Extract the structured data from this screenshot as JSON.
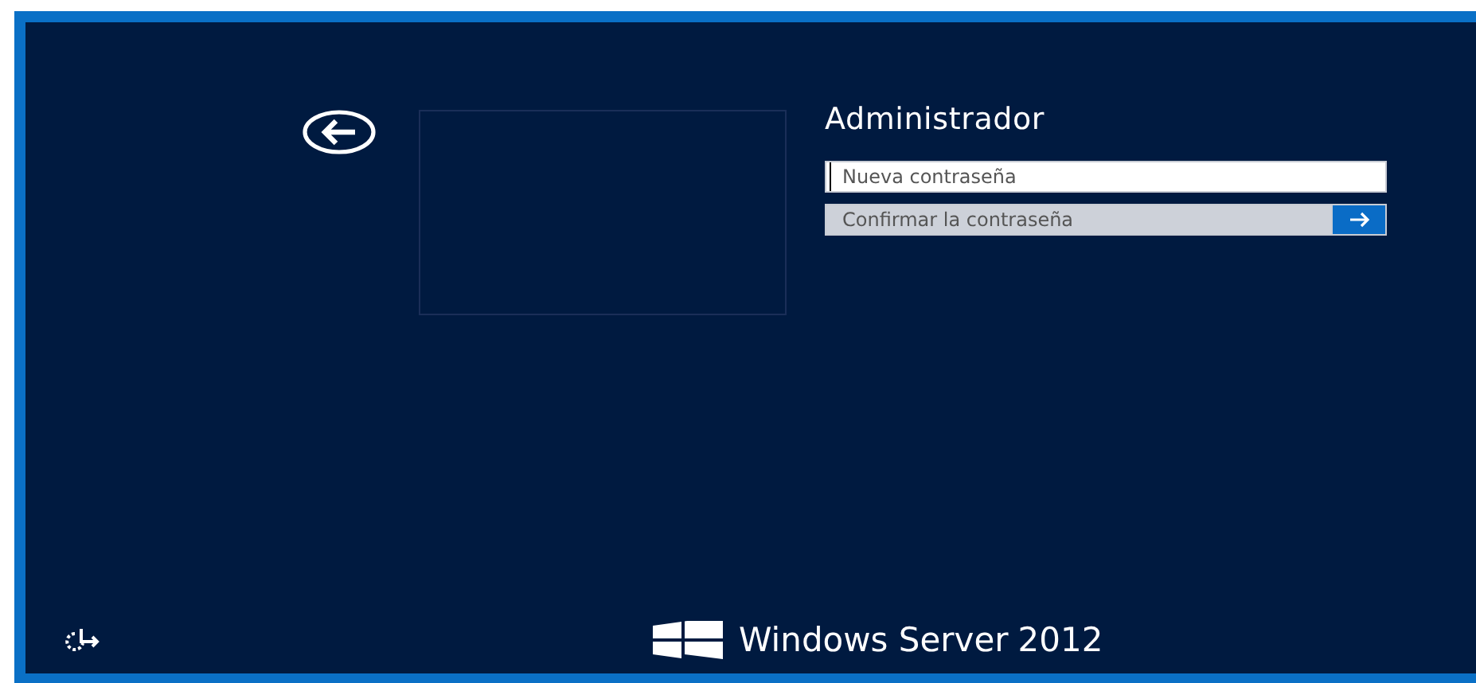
{
  "user": {
    "name": "Administrador"
  },
  "fields": [
    {
      "placeholder": "Nueva contraseña",
      "focused": true,
      "submit": false
    },
    {
      "placeholder": "Confirmar la contraseña",
      "focused": false,
      "submit": true
    }
  ],
  "brand": {
    "text": "Windows Server",
    "version": "2012"
  }
}
